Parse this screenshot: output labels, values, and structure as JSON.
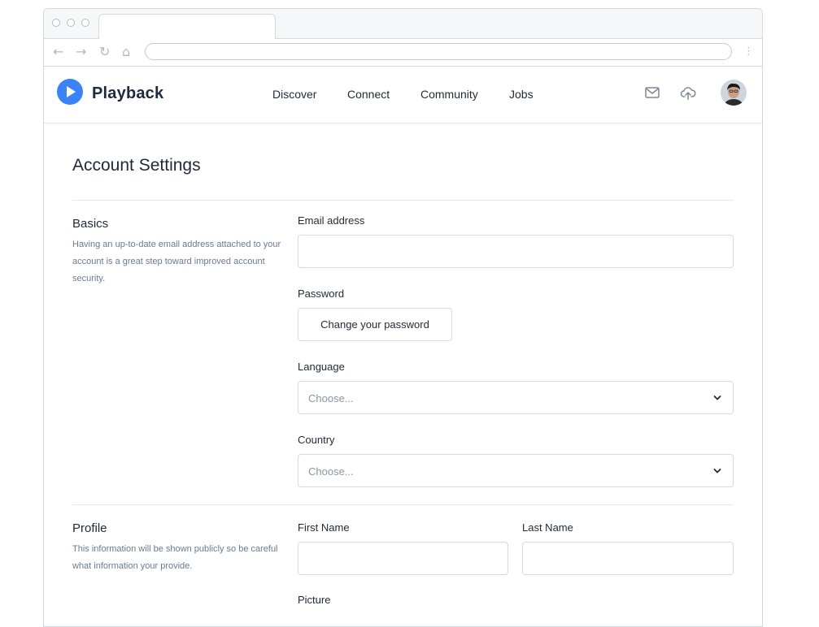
{
  "app": {
    "brand": "Playback",
    "accent_color": "#3b82f6"
  },
  "nav": {
    "links": [
      "Discover",
      "Connect",
      "Community",
      "Jobs"
    ],
    "icons": [
      "mail-icon",
      "upload-cloud-icon"
    ]
  },
  "page": {
    "title": "Account Settings"
  },
  "basics": {
    "title": "Basics",
    "description": "Having an up-to-date email address attached to your account is a great step toward improved account security.",
    "email_label": "Email address",
    "email_value": "",
    "password_label": "Password",
    "password_button": "Change your password",
    "language_label": "Language",
    "language_placeholder": "Choose...",
    "country_label": "Country",
    "country_placeholder": "Choose..."
  },
  "profile": {
    "title": "Profile",
    "description": "This information will be shown publicly so be careful what information your provide.",
    "first_name_label": "First Name",
    "last_name_label": "Last Name",
    "picture_label": "Picture"
  }
}
